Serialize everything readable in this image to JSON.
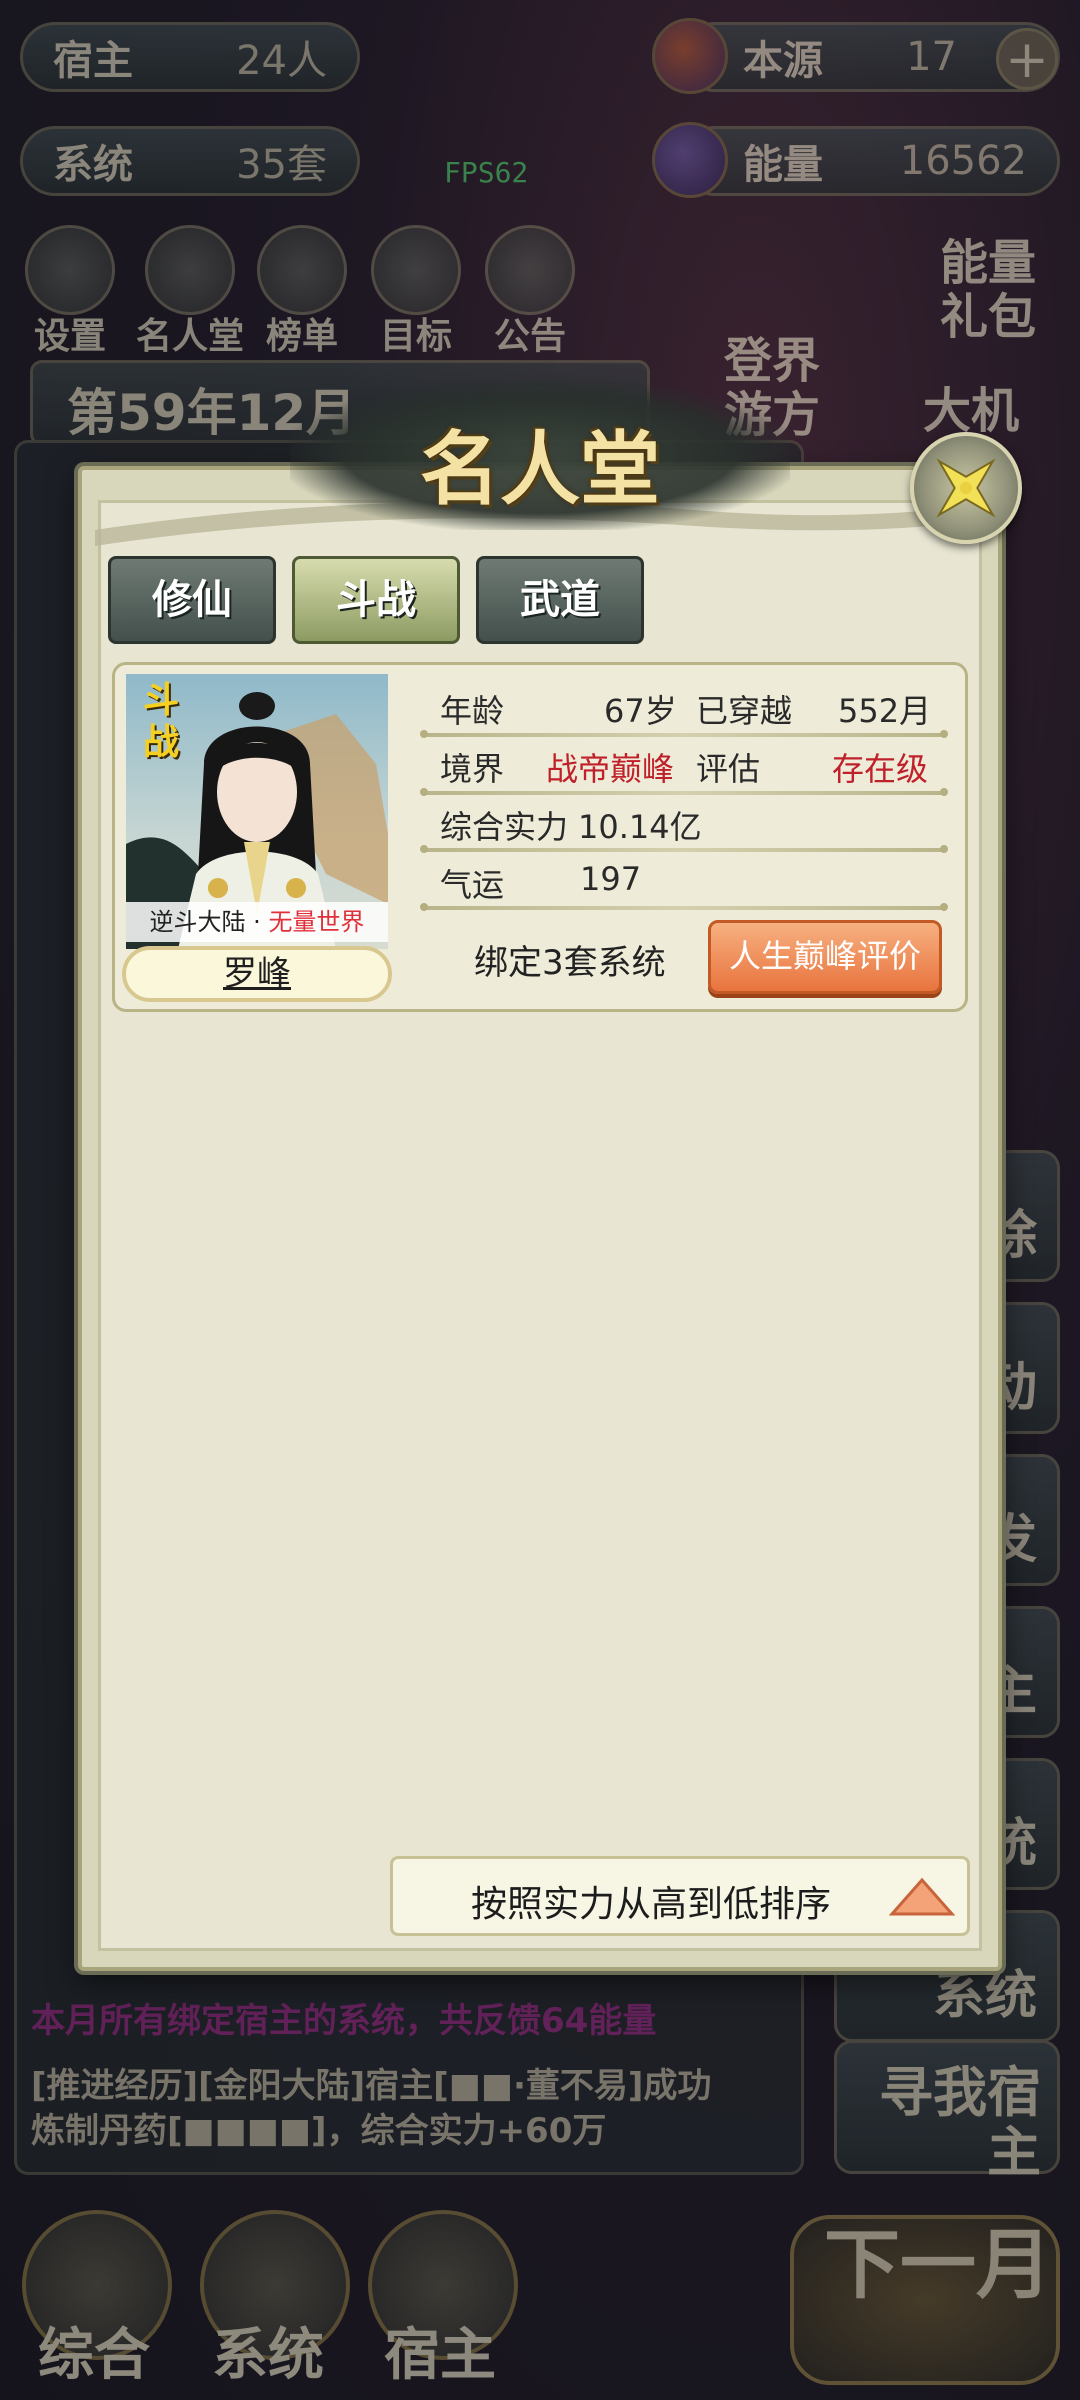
{
  "hud": {
    "host_label": "宿主",
    "host_value": "24人",
    "system_label": "系统",
    "system_value": "35套",
    "source_label": "本源",
    "source_value": "17",
    "energy_label": "能量",
    "energy_value": "16562",
    "fps": "FPS62",
    "plus": "+"
  },
  "top_menu": [
    {
      "label": "设置"
    },
    {
      "label": "名人堂"
    },
    {
      "label": "榜单"
    },
    {
      "label": "目标"
    },
    {
      "label": "公告"
    }
  ],
  "side_top": {
    "energy_pack": "能量礼包",
    "ascend": "登界游方",
    "opportunity": "大机"
  },
  "date": "第59年12月",
  "background_log": {
    "line1": "本月所有绑定宿主的系统，共反馈64能量",
    "line2": "[推进经历][金阳大陆]宿主[■■·董不易]成功",
    "line3": "炼制丹药[■■■■]，综合实力+60万"
  },
  "side_buttons": [
    "除",
    "动",
    "发",
    "主",
    "统",
    "系统",
    "寻我宿主"
  ],
  "bottom_nav": {
    "overview": "综合",
    "system": "系统",
    "host": "宿主",
    "next_month": "下一月"
  },
  "modal": {
    "title": "名人堂",
    "tabs": [
      {
        "label": "修仙",
        "active": false
      },
      {
        "label": "斗战",
        "active": true
      },
      {
        "label": "武道",
        "active": false
      }
    ],
    "entry": {
      "tag": "斗战",
      "world_prefix": "逆斗大陆 · ",
      "world_rank": "无量世界",
      "name": "罗峰",
      "age_label": "年龄",
      "age_value": "67岁",
      "traveled_label": "已穿越",
      "traveled_value": "552月",
      "realm_label": "境界",
      "realm_value": "战帝巅峰",
      "assessment_label": "评估",
      "assessment_value": "存在级",
      "power_label": "综合实力",
      "power_value": "10.14亿",
      "luck_label": "气运",
      "luck_value": "197",
      "bound_systems": "绑定3套系统",
      "peak_button": "人生巅峰评价"
    },
    "sort_label": "按照实力从高到低排序"
  },
  "colors": {
    "accent_red": "#c0202a",
    "tab_active": "#b7c285",
    "peak_button": "#ee8a52"
  }
}
